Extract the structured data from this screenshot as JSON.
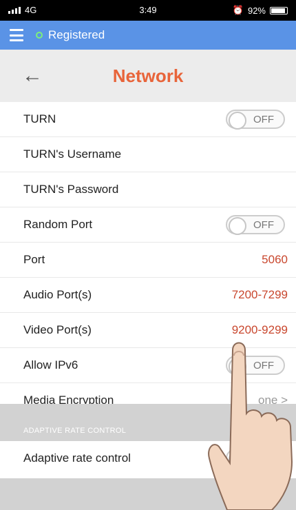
{
  "status": {
    "network": "4G",
    "time": "3:49",
    "battery": "92%"
  },
  "appbar": {
    "status_text": "Registered"
  },
  "header": {
    "title": "Network"
  },
  "settings": [
    {
      "label": "TURN",
      "toggle": "OFF"
    },
    {
      "label": "TURN's Username"
    },
    {
      "label": "TURN's Password"
    },
    {
      "label": "Random Port",
      "toggle": "OFF"
    },
    {
      "label": "Port",
      "value": "5060"
    },
    {
      "label": "Audio Port(s)",
      "value": "7200-7299"
    },
    {
      "label": "Video Port(s)",
      "value": "9200-9299"
    },
    {
      "label": "Allow IPv6",
      "toggle": "OFF"
    },
    {
      "label": "Media Encryption",
      "value": "one >"
    }
  ],
  "adaptive": {
    "section_title": "ADAPTIVE RATE CONTROL",
    "label": "Adaptive rate control"
  },
  "colors": {
    "appbar": "#5a93e6",
    "title": "#e8643a",
    "value": "#c9472e"
  }
}
